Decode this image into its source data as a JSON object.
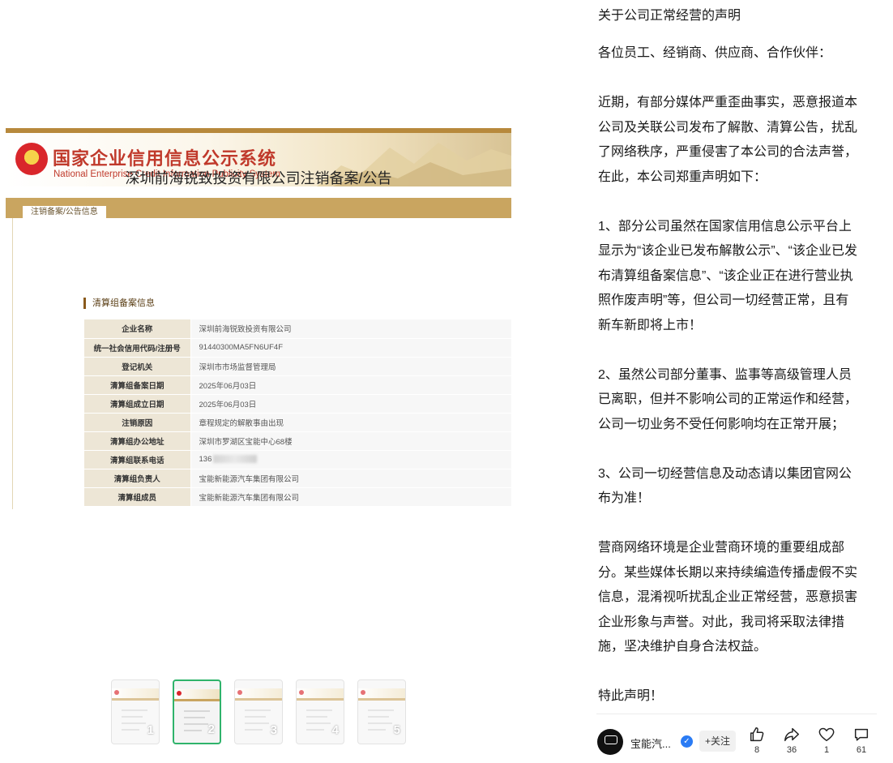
{
  "image": {
    "site_title_cn": "国家企业信用信息公示系统",
    "site_title_en": "National Enterprise Credit Information Publicity System",
    "tab_label": "注销备案/公告信息",
    "notice_title": "深圳前海锐致投资有限公司注销备案/公告",
    "section_label": "清算组备案信息",
    "rows": [
      {
        "key": "企业名称",
        "value": "深圳前海锐致投资有限公司"
      },
      {
        "key": "统一社会信用代码/注册号",
        "value": "91440300MA5FN6UF4F"
      },
      {
        "key": "登记机关",
        "value": "深圳市市场监督管理局"
      },
      {
        "key": "清算组备案日期",
        "value": "2025年06月03日"
      },
      {
        "key": "清算组成立日期",
        "value": "2025年06月03日"
      },
      {
        "key": "注销原因",
        "value": "章程规定的解散事由出现"
      },
      {
        "key": "清算组办公地址",
        "value": "深圳市罗湖区宝能中心68楼"
      },
      {
        "key": "清算组联系电话",
        "value": "136"
      },
      {
        "key": "清算组负责人",
        "value": "宝能新能源汽车集团有限公司"
      },
      {
        "key": "清算组成员",
        "value": "宝能新能源汽车集团有限公司"
      }
    ]
  },
  "thumbnails": [
    {
      "label": "1",
      "selected": false
    },
    {
      "label": "2",
      "selected": true
    },
    {
      "label": "3",
      "selected": false
    },
    {
      "label": "4",
      "selected": false
    },
    {
      "label": "5",
      "selected": false
    }
  ],
  "post": {
    "title": "关于公司正常经营的声明",
    "lines": [
      "各位员工、经销商、供应商、合作伙伴：",
      "",
      "近期，有部分媒体严重歪曲事实，恶意报道本",
      "公司及关联公司发布了解散、清算公告，扰乱",
      "了网络秩序，严重侵害了本公司的合法声誉，",
      "在此，本公司郑重声明如下：",
      "",
      "1、部分公司虽然在国家信用信息公示平台上",
      "显示为“该企业已发布解散公示”、“该企业已发",
      "布清算组备案信息”、“该企业正在进行营业执",
      "照作废声明”等，但公司一切经营正常，且有",
      "新车新即将上市！",
      "",
      "2、虽然公司部分董事、监事等高级管理人员",
      "已离职，但并不影响公司的正常运作和经营，",
      "公司一切业务不受任何影响均在正常开展；",
      "",
      "3、公司一切经营信息及动态请以集团官网公",
      "布为准！",
      "",
      "营商网络环境是企业营商环境的重要组成部",
      "分。某些媒体长期以来持续编造传播虚假不实",
      "信息，混淆视听扰乱企业正常经营，恶意损害",
      "企业形象与声誉。对此，我司将采取法律措",
      "施，坚决维护自身合法权益。",
      "",
      "特此声明！"
    ]
  },
  "footer": {
    "author": "宝能汽...",
    "follow_label": "+关注",
    "like_count": "8",
    "share_count": "36",
    "favorite_count": "1",
    "comment_count": "61"
  },
  "icons": {
    "avatar": "brand-logo-icon",
    "verified": "verified-badge-icon",
    "like": "thumbs-up-icon",
    "share": "share-arrow-icon",
    "favorite": "heart-icon",
    "comment": "comment-bubble-icon"
  },
  "colors": {
    "gov_gold": "#c9a560",
    "gov_red": "#c0392b",
    "thumb_selected": "#2fb36b",
    "verified_blue": "#2a7bf4"
  }
}
